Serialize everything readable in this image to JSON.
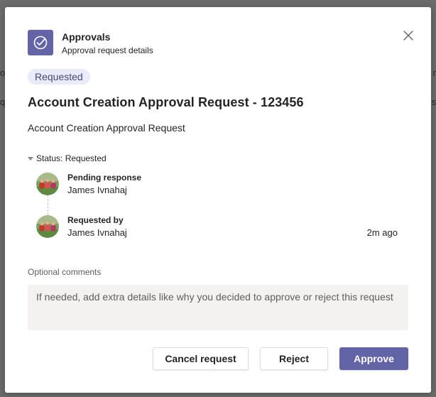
{
  "colors": {
    "accent": "#6264a7",
    "pill_bg": "#e8ebfa",
    "pill_text": "#464775",
    "comments_bg": "#f3f2f1"
  },
  "header": {
    "icon": "approval-check-icon",
    "title": "Approvals",
    "subtitle": "Approval request details",
    "close_icon": "close-icon"
  },
  "request": {
    "status_pill": "Requested",
    "title": "Account Creation Approval Request - 123456",
    "description": "Account Creation Approval Request"
  },
  "status_section": {
    "label": "Status: Requested",
    "entries": [
      {
        "label": "Pending response",
        "name": "James Ivnahaj",
        "time": ""
      },
      {
        "label": "Requested by",
        "name": "James Ivnahaj",
        "time": "2m ago"
      }
    ]
  },
  "comments": {
    "label": "Optional comments",
    "placeholder": "If needed, add extra details like why you decided to approve or reject this request",
    "value": ""
  },
  "actions": {
    "cancel_label": "Cancel request",
    "reject_label": "Reject",
    "approve_label": "Approve"
  }
}
